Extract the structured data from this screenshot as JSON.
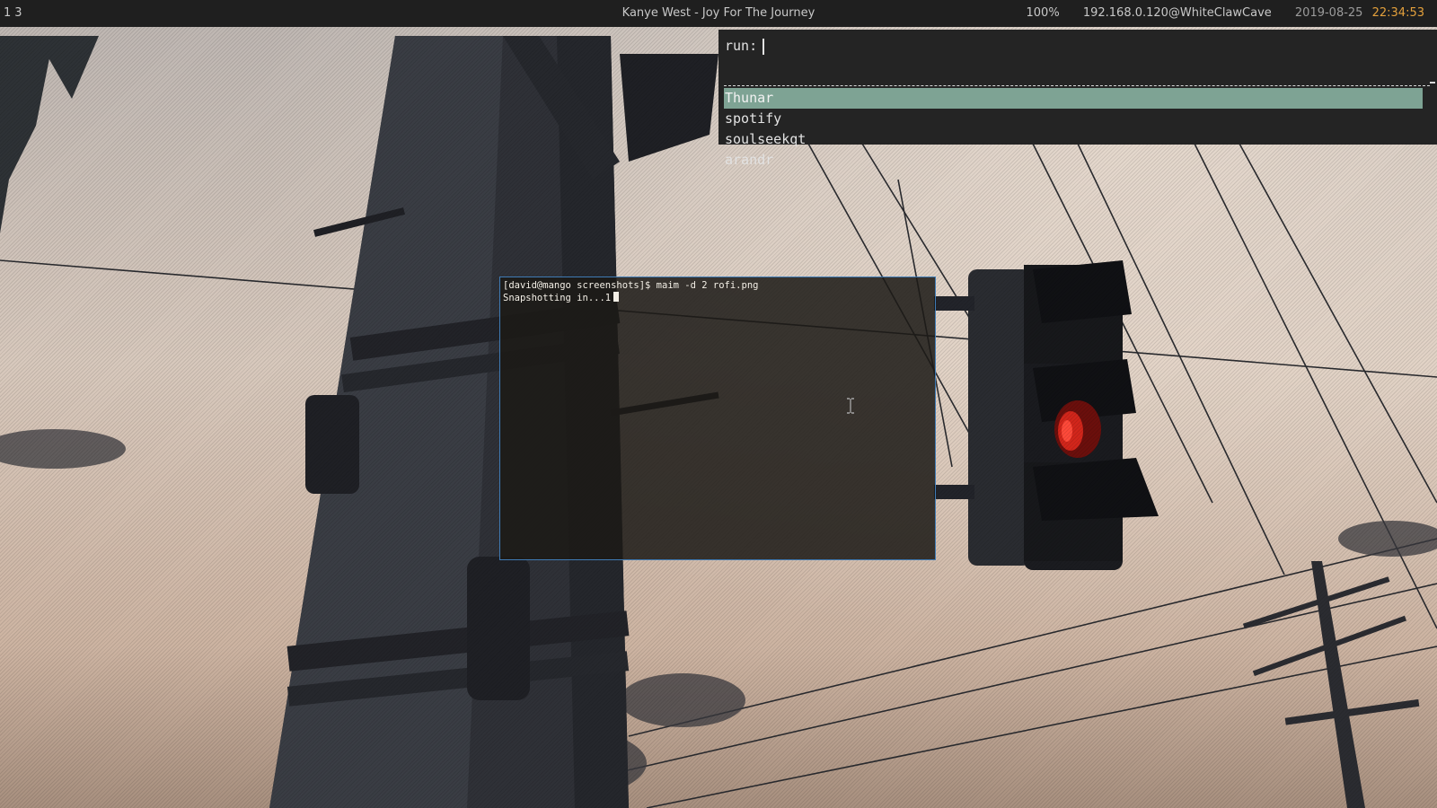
{
  "topbar": {
    "workspaces": [
      "1",
      "3"
    ],
    "now_playing": "Kanye West - Joy For The Journey",
    "volume": "100%",
    "network": "192.168.0.120@WhiteClawCave",
    "date": "2019-08-25",
    "time": "22:34:53",
    "time_color": "#e3a03c"
  },
  "rofi": {
    "prompt": "run:",
    "input_value": "",
    "items": [
      "Thunar",
      "spotify",
      "soulseekqt",
      "arandr"
    ],
    "selected_index": 0,
    "selected_color": "#7ea394"
  },
  "terminal": {
    "lines": [
      "[david@mango screenshots]$ maim -d 2 rofi.png",
      "Snapshotting in...1"
    ],
    "border_color": "#3f7bb5"
  }
}
